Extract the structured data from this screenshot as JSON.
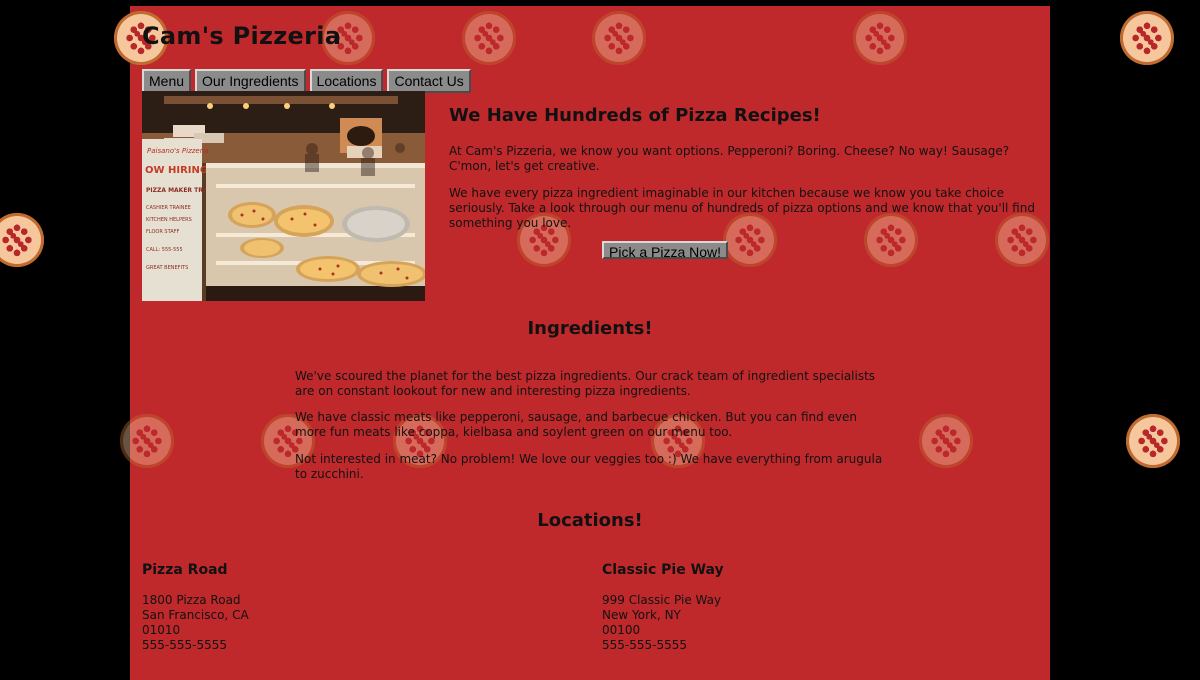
{
  "site_title": "Cam's Pizzeria",
  "nav": {
    "items": [
      "Menu",
      "Our Ingredients",
      "Locations",
      "Contact Us"
    ]
  },
  "hero": {
    "headline": "We Have Hundreds of Pizza Recipes!",
    "paragraph_1": "At Cam's Pizzeria, we know you want options. Pepperoni? Boring. Cheese? No way! Sausage? C'mon, let's get creative.",
    "paragraph_2": "We have every pizza ingredient imaginable in our kitchen because we know you take choice seriously. Take a look through our menu of hundreds of pizza options and we know that you'll find something you love.",
    "cta_label": "Pick a Pizza Now!"
  },
  "ingredients": {
    "title": "Ingredients!",
    "paragraph_1": "We've scoured the planet for the best pizza ingredients. Our crack team of ingredient specialists are on constant lookout for new and interesting pizza ingredients.",
    "paragraph_2": "We have classic meats like pepperoni, sausage, and barbecue chicken. But you can find even more fun meats like coppa, kielbasa and soylent green on our menu too.",
    "paragraph_3": "Not interested in meat? No problem! We love our veggies too :) We have everything from arugula to zucchini."
  },
  "locations": {
    "title": "Locations!",
    "items": [
      {
        "name": "Pizza Road",
        "street": "1800 Pizza Road",
        "city": "San Francisco, CA",
        "zip": "01010",
        "phone": "555-555-5555"
      },
      {
        "name": "Classic Pie Way",
        "street": "999 Classic Pie Way",
        "city": "New York, NY",
        "zip": "00100",
        "phone": "555-555-5555"
      }
    ]
  },
  "photo_sign": {
    "brand": "Paisano's Pizzeria",
    "hiring": "OW HIRING",
    "roles": "PIZZA MAKER TRAINEE",
    "details": [
      "CASHIER TRAINEE",
      "KITCHEN HELPERS",
      "FLOOR STAFF"
    ],
    "call": "CALL: 555-555",
    "footer": "GREAT BENEFITS"
  },
  "colors": {
    "page_background": "#000000",
    "panel_background": "#c0292c",
    "button_background": "#8b8b8b",
    "text": "#111111"
  },
  "icons": [
    "pizza-icon"
  ]
}
